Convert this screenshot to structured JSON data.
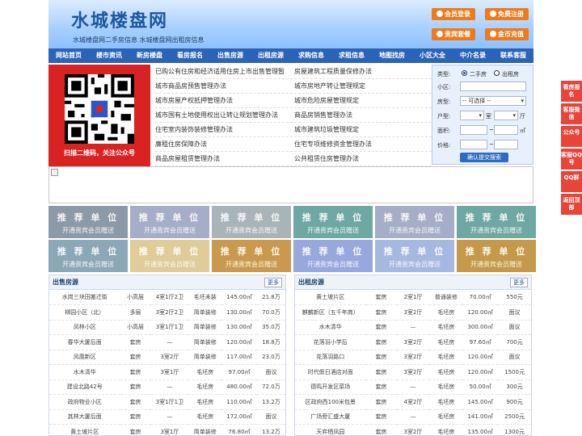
{
  "header": {
    "title": "水城楼盘网",
    "subtitle": "水城楼盘网二手房信息    水城楼盘网出租房信息",
    "buttons": [
      "会员登录",
      "免费注册",
      "贵宾套餐",
      "金币充值"
    ]
  },
  "nav": [
    "网站首页",
    "楼市资讯",
    "新房楼盘",
    "看房报名",
    "出售房源",
    "出租房源",
    "求购信息",
    "求租信息",
    "地图找房",
    "小区大全",
    "中介名录",
    "联系客服"
  ],
  "qr": {
    "caption": "扫描二维码，关注公众号"
  },
  "links_left": [
    "已购公有住房和经济适用住房上市出售管理暂",
    "城市商品房预售管理办法",
    "城市房屋产权抵押管理办法",
    "城市国有土地使用权出让转让规划管理办法",
    "住宅室内装饰装修管理办法",
    "廉租住房保障办法",
    "商品房屋租赁管理办法"
  ],
  "links_right": [
    "房屋建筑工程质量保修办法",
    "城市房地产转让管理规定",
    "城市危险房屋管理规定",
    "商品房销售管理办法",
    "城市建筑垃圾管理规定",
    "住宅专项维修资金管理办法",
    "公共租赁住房管理办法"
  ],
  "search": {
    "type_label": "类型:",
    "opt1": "二手房",
    "opt2": "出租房",
    "community_label": "小区:",
    "house_label": "房型:",
    "house_select": "-- 可选择 --",
    "layout_label": "户型:",
    "room_unit": "室",
    "hall_unit": "厅",
    "area_label": "面积:",
    "area_unit": "㎡",
    "price_label": "价格:",
    "range_sep": "~",
    "submit": "确认提交搜索"
  },
  "ads": {
    "line1": "推 荐 单 位",
    "line2": "开通贵宾会员赠送"
  },
  "ad_colors": [
    "#8c9aa8",
    "#a6aec7",
    "#a9b4b8",
    "#6fa8a2",
    "#a6aec7",
    "#6fa8a2",
    "#8aa8b8",
    "#e0cc98",
    "#c99a4e",
    "#98a8dc",
    "#a6b8e0",
    "#c49a4a"
  ],
  "sale": {
    "title": "出售房源",
    "more": "更多",
    "rows": [
      [
        "水岗三块田搬迁街",
        "小高层",
        "4室1厅2卫",
        "毛坯未装",
        "145.00㎡",
        "21.8万"
      ],
      [
        "柳园小区（北）",
        "多层",
        "3室2厅2卫",
        "简单装修",
        "130.00㎡",
        "70.0万"
      ],
      [
        "凤林小区",
        "小高层",
        "3室1厅1卫",
        "简单装修",
        "130.00㎡",
        "35.0万"
      ],
      [
        "春华大厦后面",
        "套房",
        "—",
        "简单装修",
        "120.00㎡",
        "18.8万"
      ],
      [
        "凤凰新区",
        "套房",
        "3室2厅",
        "简单装修",
        "117.00㎡",
        "23.0万"
      ],
      [
        "水木清华",
        "套房",
        "3室1厅",
        "毛坯房",
        "97.00㎡",
        "面议"
      ],
      [
        "建设北路42号",
        "套房",
        "—",
        "毛坯房",
        "480.00㎡",
        "72.0万"
      ],
      [
        "政府物业小区",
        "套房",
        "3室1厅1卫",
        "毛坯房",
        "110.00㎡",
        "13.2万"
      ],
      [
        "其林大厦后面",
        "套房",
        "—",
        "毛坯房",
        "172.00㎡",
        "面议"
      ],
      [
        "黄土坡片区",
        "套房",
        "3室1厅",
        "简单装修",
        "76.80㎡",
        "13.2万"
      ]
    ]
  },
  "rent": {
    "title": "出租房源",
    "more": "更多",
    "rows": [
      [
        "黄土坡片区",
        "套房",
        "2室1厅",
        "普通装修",
        "70.00㎡",
        "550元"
      ],
      [
        "麒麟新区（五千年商）",
        "套房",
        "3室2厅",
        "毛坯房",
        "120.00㎡",
        "面议"
      ],
      [
        "水木清华",
        "套房",
        "—",
        "毛坯房",
        "300.00㎡",
        "面议"
      ],
      [
        "花落羽小学后",
        "套房",
        "3室2厅",
        "毛坯房",
        "97.60㎡",
        "700元"
      ],
      [
        "花落羽路口",
        "套房",
        "3室2厅",
        "毛坯房",
        "120.00㎡",
        "面议"
      ],
      [
        "时代假日酒店对面",
        "套房",
        "3室2厅",
        "毛坯房",
        "120.00㎡",
        "1500元"
      ],
      [
        "德鸣开发区菜场",
        "套房",
        "—",
        "毛坯房",
        "50.00㎡",
        "300元"
      ],
      [
        "区政府西100米包景",
        "套房",
        "4室2厅",
        "毛坯房",
        "145.00㎡",
        "900元"
      ],
      [
        "广场旁汇盛大厦",
        "套房",
        "—",
        "毛坯房",
        "141.00㎡",
        "2500元"
      ],
      [
        "天弈栖凤园",
        "套房",
        "3室2厅",
        "毛坯房",
        "135.00㎡",
        "1300元"
      ]
    ]
  },
  "side": [
    "看房报名",
    "客服微信",
    "公众号",
    "客服QQ号",
    "QQ群",
    "返回顶部"
  ]
}
